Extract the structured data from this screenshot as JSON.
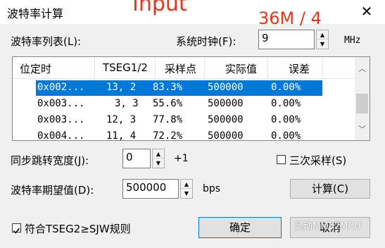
{
  "window": {
    "title": "波特率计算",
    "close_glyph": "✕"
  },
  "overlay": {
    "top_text": "Input",
    "top_right_text": "36M / 4",
    "color": "#e8341c"
  },
  "baud_list_label": "波特率列表(L):",
  "sys_clock": {
    "label": "系统时钟(F):",
    "value": "9",
    "unit": "MHz"
  },
  "table": {
    "columns": [
      "位定时",
      "TSEG1/2",
      "采样点",
      "实际值",
      "误差"
    ],
    "rows": [
      [
        "0x002...",
        "13, 2",
        "83.3%",
        "500000",
        "0.00%"
      ],
      [
        "0x003...",
        "3, 3",
        "55.6%",
        "500000",
        "0.00%"
      ],
      [
        "0x003...",
        "12, 3",
        "77.8%",
        "500000",
        "0.00%"
      ],
      [
        "0x004...",
        "11, 4",
        "72.2%",
        "500000",
        "0.00%"
      ]
    ],
    "selected_row": 0,
    "selection_color": "#0078d7"
  },
  "sjw": {
    "label": "同步跳转宽度(J):",
    "value": "0",
    "suffix": "+1"
  },
  "triple_sample": {
    "label": "三次采样(S)",
    "checked": false
  },
  "baud_target": {
    "label": "波特率期望值(D):",
    "value": "500000",
    "unit": "bps"
  },
  "calc_button": "计算(C)",
  "rule_check": {
    "label": "符合TSEG2≥SJW规则",
    "checked": true
  },
  "ok_button": "确定",
  "cancel_button": "取消",
  "watermark": "灵动MM32MCU"
}
